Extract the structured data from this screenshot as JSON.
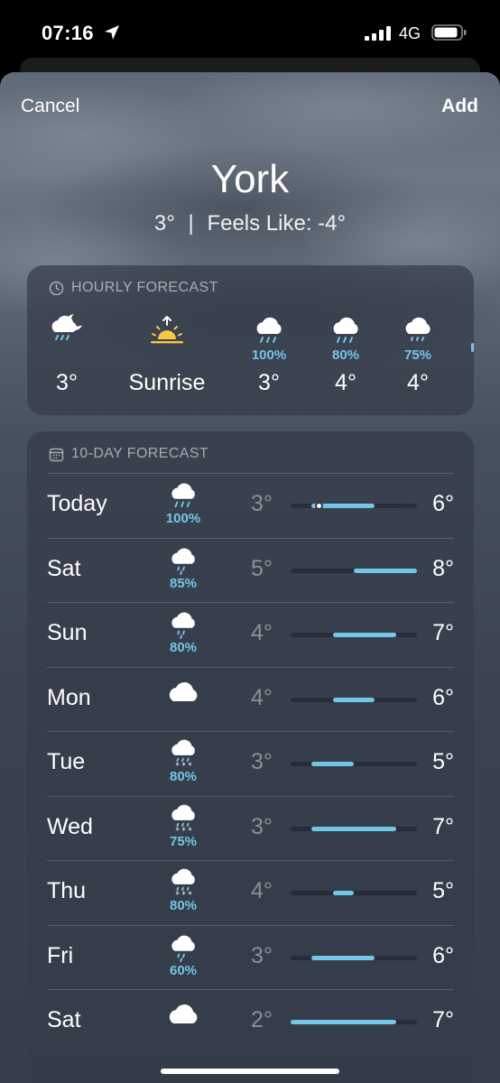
{
  "status_bar": {
    "time": "07:16",
    "network": "4G"
  },
  "nav": {
    "cancel_label": "Cancel",
    "add_label": "Add"
  },
  "location": {
    "city": "York",
    "temp": "3°",
    "separator": "|",
    "feels_like": "Feels Like: -4°"
  },
  "hourly": {
    "header": "HOURLY FORECAST",
    "items": [
      {
        "icon": "cloud-moon-rain-icon",
        "pct": "",
        "temp": "3°"
      },
      {
        "icon": "sunrise-icon",
        "pct": "",
        "temp": "Sunrise"
      },
      {
        "icon": "cloud-rain-icon",
        "pct": "100%",
        "temp": "3°"
      },
      {
        "icon": "cloud-rain-icon",
        "pct": "80%",
        "temp": "4°"
      },
      {
        "icon": "cloud-rain-icon",
        "pct": "75%",
        "temp": "4°"
      }
    ]
  },
  "ten_day": {
    "header": "10-DAY FORECAST",
    "scale_min": 2,
    "scale_max": 8,
    "current_temp": 3,
    "days": [
      {
        "day": "Today",
        "icon": "cloud-rain-icon",
        "pct": "100%",
        "lo": "3°",
        "hi": "6°",
        "lo_val": 3,
        "hi_val": 6
      },
      {
        "day": "Sat",
        "icon": "cloud-drizzle-icon",
        "pct": "85%",
        "lo": "5°",
        "hi": "8°",
        "lo_val": 5,
        "hi_val": 8
      },
      {
        "day": "Sun",
        "icon": "cloud-drizzle-icon",
        "pct": "80%",
        "lo": "4°",
        "hi": "7°",
        "lo_val": 4,
        "hi_val": 7
      },
      {
        "day": "Mon",
        "icon": "cloud-icon",
        "pct": "",
        "lo": "4°",
        "hi": "6°",
        "lo_val": 4,
        "hi_val": 6
      },
      {
        "day": "Tue",
        "icon": "cloud-sleet-icon",
        "pct": "80%",
        "lo": "3°",
        "hi": "5°",
        "lo_val": 3,
        "hi_val": 5
      },
      {
        "day": "Wed",
        "icon": "cloud-sleet-icon",
        "pct": "75%",
        "lo": "3°",
        "hi": "7°",
        "lo_val": 3,
        "hi_val": 7
      },
      {
        "day": "Thu",
        "icon": "cloud-sleet-icon",
        "pct": "80%",
        "lo": "4°",
        "hi": "5°",
        "lo_val": 4,
        "hi_val": 5
      },
      {
        "day": "Fri",
        "icon": "cloud-drizzle-icon",
        "pct": "60%",
        "lo": "3°",
        "hi": "6°",
        "lo_val": 3,
        "hi_val": 6
      },
      {
        "day": "Sat",
        "icon": "cloud-icon",
        "pct": "",
        "lo": "2°",
        "hi": "7°",
        "lo_val": 2,
        "hi_val": 7
      }
    ]
  },
  "colors": {
    "accent": "#74c6e8",
    "card": "#343c4a",
    "text": "#ffffff"
  }
}
